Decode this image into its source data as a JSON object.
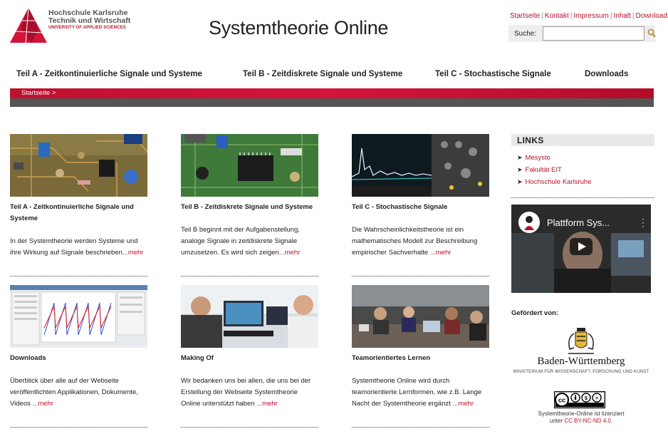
{
  "header": {
    "logo": {
      "line1": "Hochschule Karlsruhe",
      "line2": "Technik und Wirtschaft",
      "line3": "UNIVERSITY OF APPLIED SCIENCES"
    },
    "site_title": "Systemtheorie Online",
    "top_links": [
      "Startseite",
      "Kontakt",
      "Impressum",
      "Inhalt",
      "Downloads"
    ],
    "search": {
      "label": "Suche:",
      "value": "",
      "placeholder": ""
    }
  },
  "nav": {
    "items": [
      "Teil A - Zeitkontinuierliche Signale und Systeme",
      "Teil B - Zeitdiskrete Signale und Systeme",
      "Teil C - Stochastische Signale",
      "Downloads"
    ]
  },
  "breadcrumb": "Startseite >",
  "cards": [
    {
      "title": "Teil A - Zeitkontinuierliche Signale und Systeme",
      "text": "In der Systemtheorie werden Systeme und ihre Wirkung auf Signale beschrieben",
      "more": "...mehr",
      "image": "circuit-board-photo"
    },
    {
      "title": "Teil B - Zeitdiskrete Signale und Systeme",
      "text": "Teil B beginnt mit der Aufgabenstellung, analoge Signale in zeitdiskrete Signale umzusetzen. Es wird sich zeigen",
      "more": "...mehr",
      "image": "microchip-photo"
    },
    {
      "title": "Teil C - Stochastische Signale",
      "text": "Die Wahrscheinlichkeitstheorie ist ein mathematisches Modell zur Beschreibung empirischer Sachverhalte",
      "more": " ...mehr",
      "image": "oscilloscope-photo"
    },
    {
      "title": "Downloads",
      "text": "Überblick über alle auf der Webseite veröffentlichten Applikationen, Dokumente, Videos",
      "more": " ...mehr",
      "image": "software-screenshot"
    },
    {
      "title": "Making Of",
      "text": "Wir bedanken uns bei allen, die uns bei der Erstellung der Webseite Systemtheorie Online unterstützt haben",
      "more": " ...mehr",
      "image": "team-at-computer-photo"
    },
    {
      "title": "Teamorientiertes Lernen",
      "text": "Systemtheorie Online wird durch teamorientierte Lernformen, wie z.B. Lange Nacht der Systemtheorie ergänzt",
      "more": " ...mehr",
      "image": "students-learning-photo"
    }
  ],
  "sidebar": {
    "links_heading": "LINKS",
    "links": [
      "Mesysto",
      "Fakultät EIT",
      "Hochschule Karlsruhe"
    ],
    "video_title": "Plattform Sys...",
    "funded_by": "Gefördert von:",
    "funder_name": "Baden-Württemberg",
    "funder_ministry": "MINISTERIUM FÜR WISSENSCHAFT, FORSCHUNG UND KUNST",
    "license_line1": "Systemtheorie-Online ist lizenziert",
    "license_prefix": "unter ",
    "license_link": "CC BY-NC-ND 4.0",
    "license_suffix": "."
  },
  "colors": {
    "brand_red": "#b5122d",
    "bar_gray": "#555555"
  }
}
